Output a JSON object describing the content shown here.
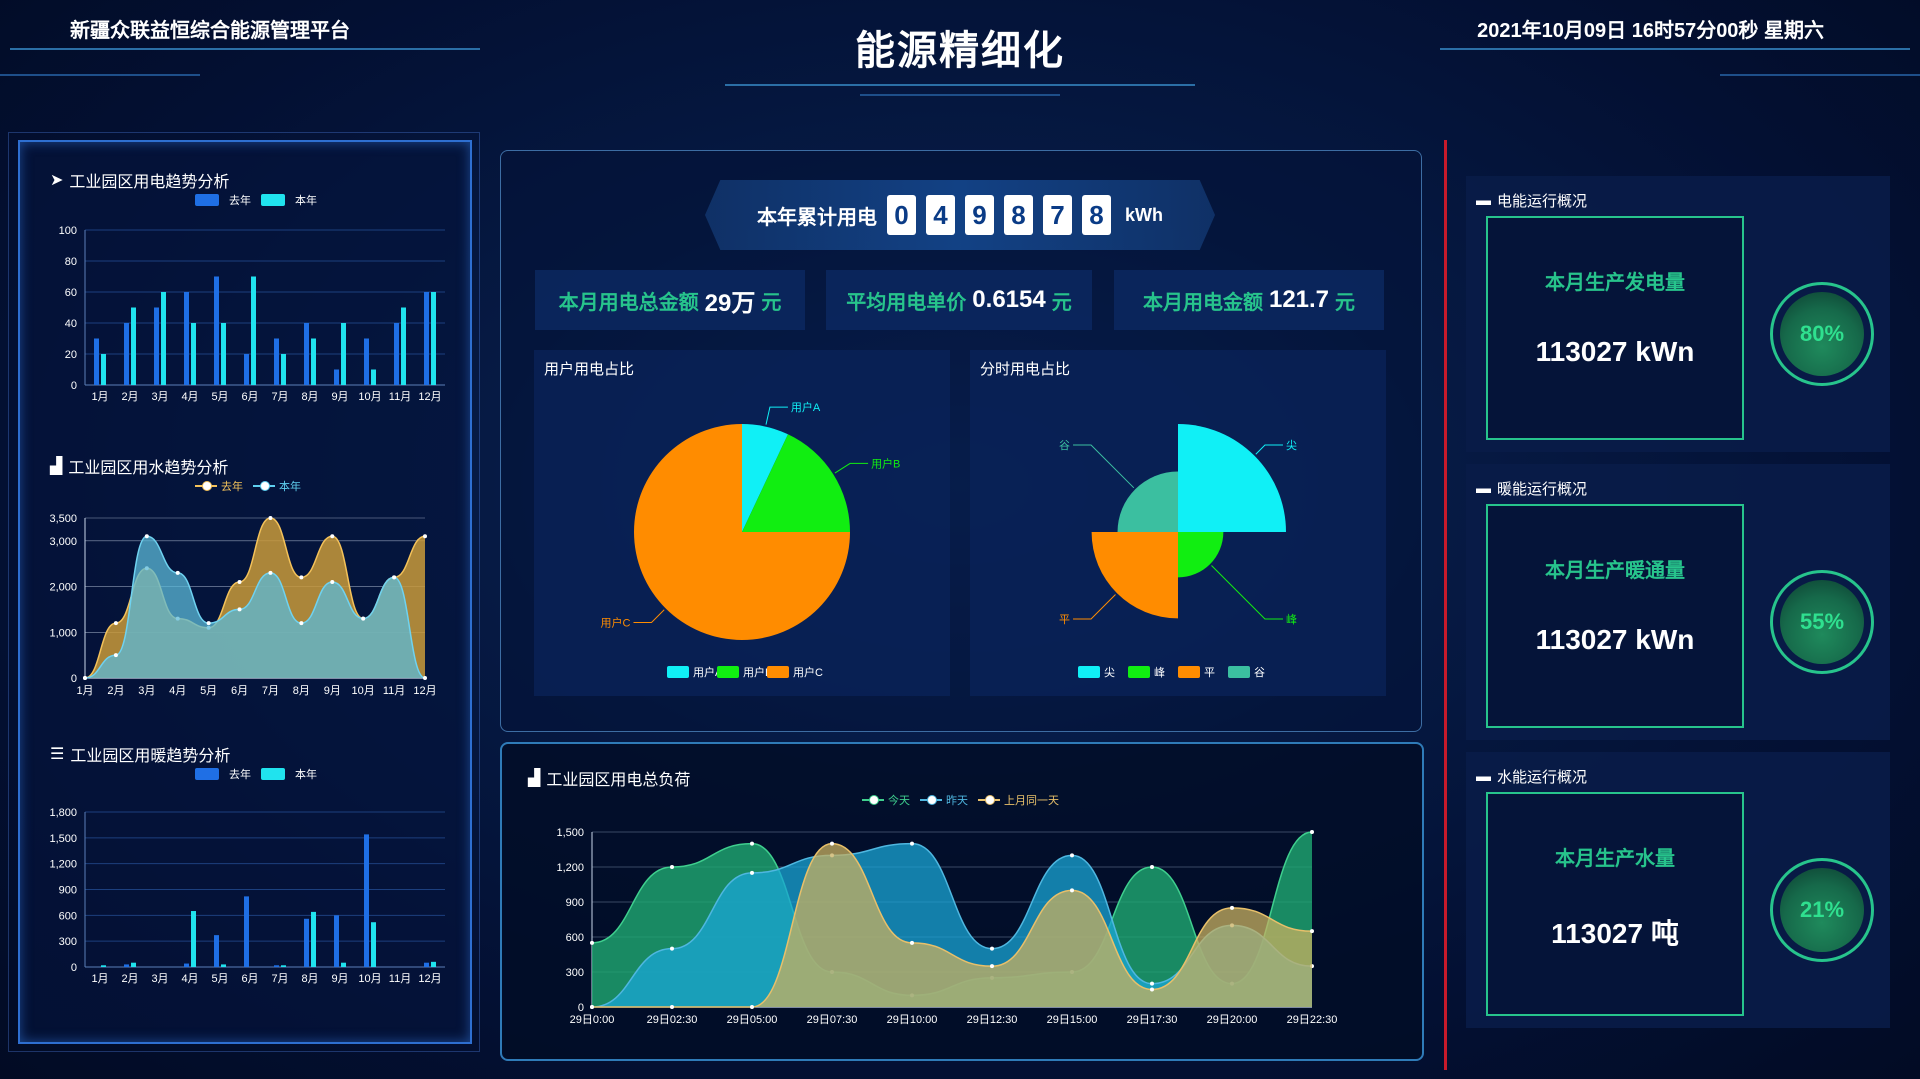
{
  "header": {
    "platform_name": "新疆众联益恒综合能源管理平台",
    "page_title": "能源精细化",
    "datetime": "2021年10月09日 16时57分00秒 星期六"
  },
  "colors": {
    "last_year_bar": "#1f6fe5",
    "this_year_bar": "#20e3ee",
    "accent_green": "#27c48c",
    "frame_red": "#c81a2b"
  },
  "left": {
    "power_chart": {
      "title": "工业园区用电趋势分析",
      "legend": [
        "去年",
        "本年"
      ]
    },
    "water_chart": {
      "title": "工业园区用水趋势分析",
      "legend": [
        "去年",
        "本年"
      ]
    },
    "heat_chart": {
      "title": "工业园区用暖趋势分析",
      "legend": [
        "去年",
        "本年"
      ]
    }
  },
  "center": {
    "counter": {
      "label": "本年累计用电",
      "digits": [
        "0",
        "4",
        "9",
        "8",
        "7",
        "8"
      ],
      "unit": "kWh"
    },
    "stats": [
      {
        "label": "本月用电总金额",
        "value": "29万",
        "unit": "元"
      },
      {
        "label": "平均用电单价",
        "value": "0.6154",
        "unit": "元"
      },
      {
        "label": "本月用电金额",
        "value": "121.7",
        "unit": "元"
      }
    ],
    "user_pie_title": "用户用电占比",
    "time_pie_title": "分时用电占比",
    "load_chart_title": "工业园区用电总负荷",
    "load_legend": [
      "今天",
      "昨天",
      "上月同一天"
    ]
  },
  "right": {
    "cards": [
      {
        "title": "电能运行概况",
        "label": "本月生产发电量",
        "value": "113027 kWn",
        "percent": "80%"
      },
      {
        "title": "暖能运行概况",
        "label": "本月生产暖通量",
        "value": "113027 kWn",
        "percent": "55%"
      },
      {
        "title": "水能运行概况",
        "label": "本月生产水量",
        "value": "113027 吨",
        "percent": "21%"
      }
    ]
  },
  "chart_data": [
    {
      "id": "power",
      "type": "bar",
      "title": "工业园区用电趋势分析",
      "categories": [
        "1月",
        "2月",
        "3月",
        "4月",
        "5月",
        "6月",
        "7月",
        "8月",
        "9月",
        "10月",
        "11月",
        "12月"
      ],
      "series": [
        {
          "name": "去年",
          "values": [
            30,
            40,
            50,
            60,
            70,
            20,
            30,
            40,
            10,
            30,
            40,
            60
          ]
        },
        {
          "name": "本年",
          "values": [
            20,
            50,
            60,
            40,
            40,
            70,
            20,
            30,
            40,
            10,
            50,
            60
          ]
        }
      ],
      "ylim": [
        0,
        100
      ],
      "yticks": [
        0,
        20,
        40,
        60,
        80,
        100
      ]
    },
    {
      "id": "water",
      "type": "area",
      "title": "工业园区用水趋势分析",
      "categories": [
        "1月",
        "2月",
        "3月",
        "4月",
        "5月",
        "6月",
        "7月",
        "8月",
        "9月",
        "10月",
        "11月",
        "12月"
      ],
      "series": [
        {
          "name": "去年",
          "values": [
            0,
            1200,
            2400,
            1300,
            1100,
            2100,
            3500,
            2200,
            3100,
            1300,
            2200,
            3100
          ]
        },
        {
          "name": "本年",
          "values": [
            0,
            500,
            3100,
            2300,
            1200,
            1500,
            2300,
            1200,
            2100,
            1300,
            2200,
            0
          ]
        }
      ],
      "ylim": [
        0,
        3500
      ],
      "yticks": [
        "0",
        "1,000",
        "2,000",
        "3,000",
        "3,500"
      ]
    },
    {
      "id": "heat",
      "type": "bar",
      "title": "工业园区用暖趋势分析",
      "categories": [
        "1月",
        "2月",
        "3月",
        "4月",
        "5月",
        "6月",
        "7月",
        "8月",
        "9月",
        "10月",
        "11月",
        "12月"
      ],
      "series": [
        {
          "name": "去年",
          "values": [
            0,
            30,
            0,
            40,
            370,
            820,
            20,
            560,
            600,
            1540,
            0,
            50
          ]
        },
        {
          "name": "本年",
          "values": [
            20,
            50,
            0,
            650,
            30,
            0,
            20,
            640,
            50,
            520,
            0,
            60
          ]
        }
      ],
      "ylim": [
        0,
        1800
      ],
      "yticks": [
        "0",
        "300",
        "600",
        "900",
        "1,200",
        "1,500",
        "1,800"
      ]
    },
    {
      "id": "user_pie",
      "type": "pie",
      "title": "用户用电占比",
      "series": [
        {
          "name": "用户A",
          "value": 7
        },
        {
          "name": "用户B",
          "value": 18
        },
        {
          "name": "用户C",
          "value": 75
        }
      ]
    },
    {
      "id": "time_pie",
      "type": "pie",
      "title": "分时用电占比",
      "series": [
        {
          "name": "尖",
          "value": 100
        },
        {
          "name": "峰",
          "value": 42
        },
        {
          "name": "平",
          "value": 80
        },
        {
          "name": "谷",
          "value": 56
        }
      ]
    },
    {
      "id": "load",
      "type": "area",
      "title": "工业园区用电总负荷",
      "x": [
        "29日0:00",
        "29日02:30",
        "29日05:00",
        "29日07:30",
        "29日10:00",
        "29日12:30",
        "29日15:00",
        "29日17:30",
        "29日20:00",
        "29日22:30"
      ],
      "series": [
        {
          "name": "今天",
          "values": [
            550,
            1200,
            1400,
            300,
            100,
            250,
            300,
            1200,
            200,
            1500
          ]
        },
        {
          "name": "昨天",
          "values": [
            0,
            500,
            1150,
            1300,
            1400,
            500,
            1300,
            200,
            700,
            350
          ]
        },
        {
          "name": "上月同一天",
          "values": [
            0,
            0,
            0,
            1400,
            550,
            350,
            1000,
            150,
            850,
            650
          ]
        }
      ],
      "ylim": [
        0,
        1500
      ],
      "yticks": [
        "0",
        "300",
        "600",
        "900",
        "1,200",
        "1,500"
      ]
    }
  ]
}
